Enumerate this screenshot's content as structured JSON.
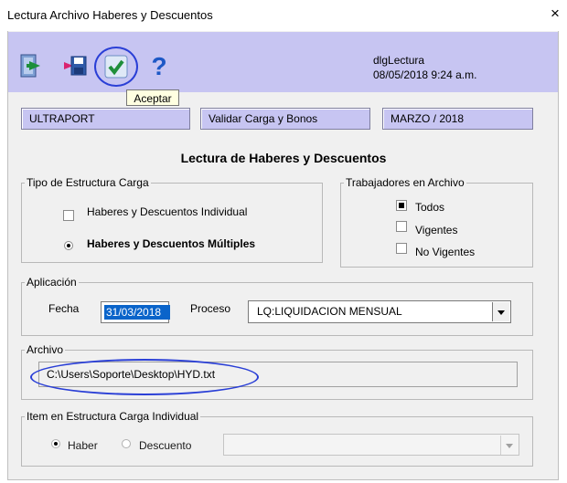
{
  "window": {
    "title": "Lectura Archivo Haberes y Descuentos",
    "close_symbol": "×"
  },
  "toolbar": {
    "icons": [
      "exit-door-icon",
      "save-icon",
      "checkmark-icon",
      "question-mark-icon"
    ],
    "tooltip": "Aceptar",
    "info_dialog": "dlgLectura",
    "info_datetime": "08/05/2018 9:24 a.m."
  },
  "header_boxes": [
    "ULTRAPORT",
    "Validar Carga y Bonos",
    "MARZO / 2018"
  ],
  "heading": "Lectura de Haberes y Descuentos",
  "tipo_estructura": {
    "legend": "Tipo de Estructura Carga",
    "option_individual": "Haberes y Descuentos Individual",
    "option_multiples": "Haberes y Descuentos Múltiples",
    "selected": "multiples"
  },
  "trabajadores": {
    "legend": "Trabajadores en Archivo",
    "todos": "Todos",
    "vigentes": "Vigentes",
    "no_vigentes": "No Vigentes",
    "selected": "todos"
  },
  "aplicacion": {
    "legend": "Aplicación",
    "fecha_label": "Fecha",
    "fecha_value": "31/03/2018",
    "proceso_label": "Proceso",
    "proceso_value": "LQ:LIQUIDACION MENSUAL"
  },
  "archivo": {
    "legend": "Archivo",
    "path": "C:\\Users\\Soporte\\Desktop\\HYD.txt"
  },
  "item_estructura": {
    "legend": "Item en Estructura Carga Individual",
    "haber": "Haber",
    "descuento": "Descuento",
    "selected": "haber"
  },
  "colors": {
    "toolbar_bg": "#c7c5f2",
    "highlight_ellipse": "#2a3fd6",
    "selection": "#0a64ca"
  }
}
